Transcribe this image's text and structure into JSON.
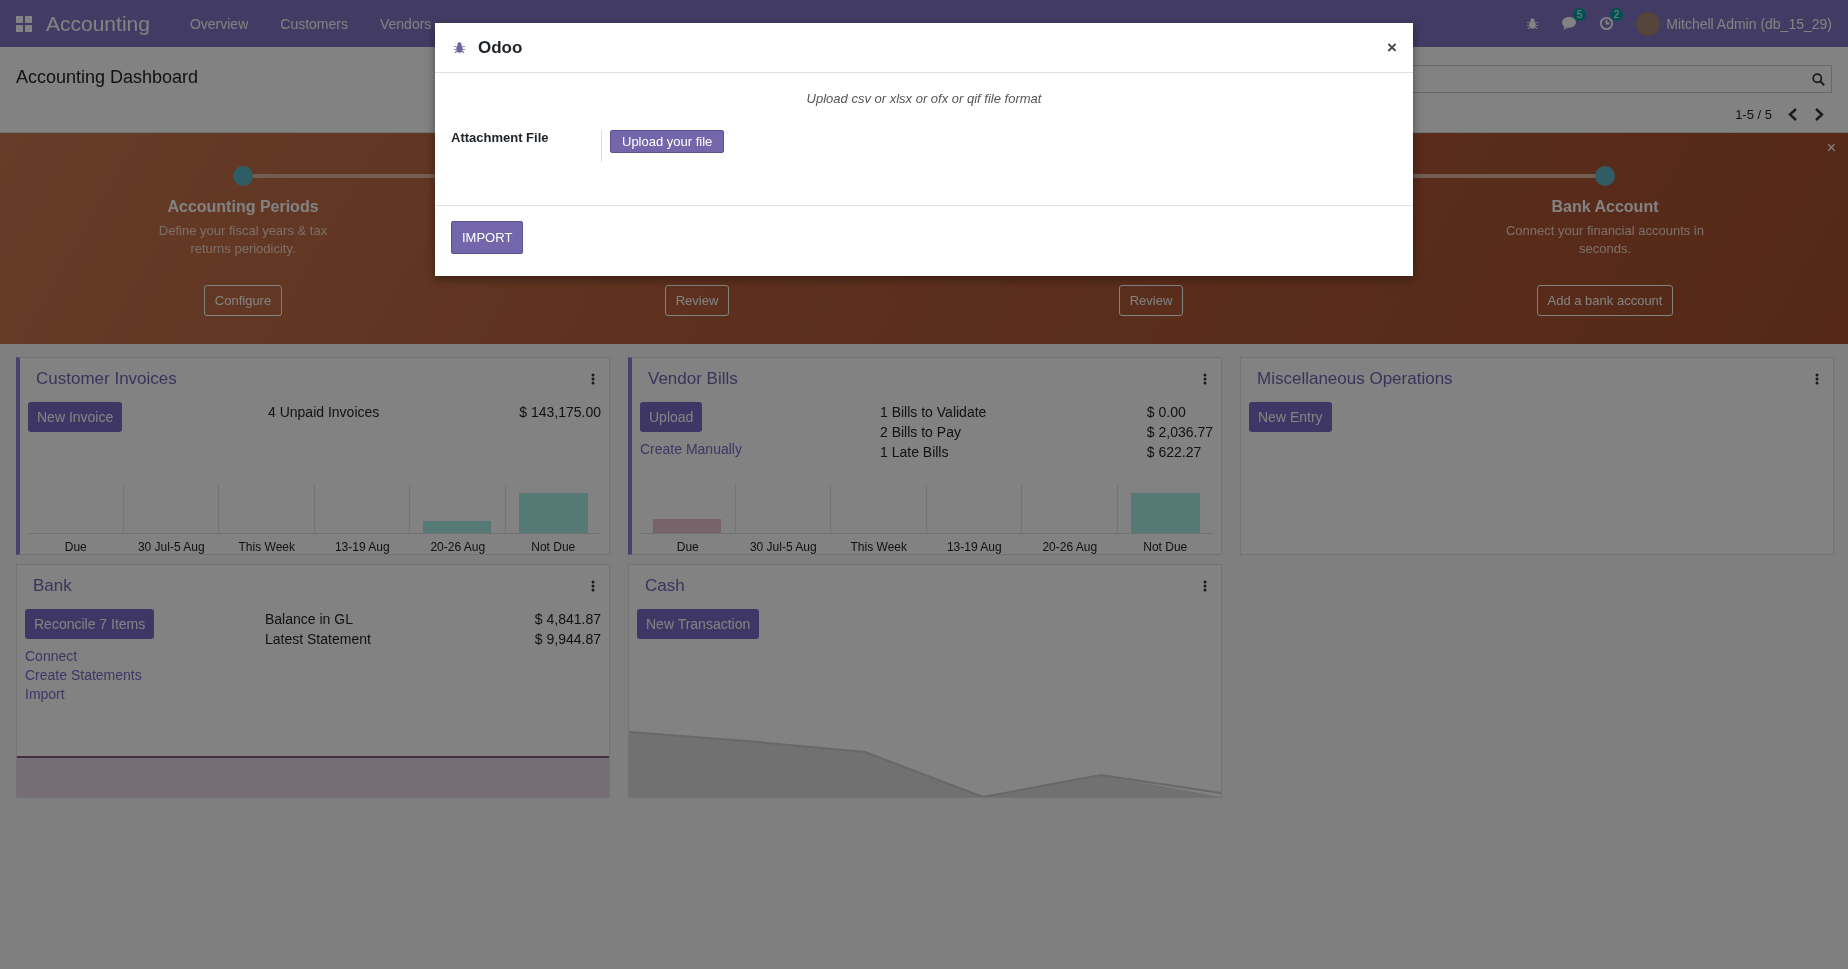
{
  "navbar": {
    "app": "Accounting",
    "menu": [
      "Overview",
      "Customers",
      "Vendors"
    ],
    "messages_count": "5",
    "activities_count": "2",
    "user": "Mitchell Admin (db_15_29)"
  },
  "control_panel": {
    "breadcrumb": "Accounting Dashboard",
    "pager": "1-5 / 5"
  },
  "onboarding": {
    "steps": [
      {
        "title": "Accounting Periods",
        "description": "Define your fiscal years & tax returns periodicity.",
        "button": "Configure"
      },
      {
        "button": "Review"
      },
      {
        "button": "Review"
      },
      {
        "title": "Bank Account",
        "description": "Connect your financial accounts in seconds.",
        "button": "Add a bank account"
      }
    ],
    "close": "×"
  },
  "journals": [
    {
      "title": "Customer Invoices",
      "kind": "bars",
      "accent": true,
      "actions": [
        {
          "label": "New Invoice",
          "kind": "button"
        }
      ],
      "stats": [
        {
          "label": "4 Unpaid Invoices",
          "value": "$ 143,175.00"
        }
      ],
      "bar_labels": [
        "Due",
        "30 Jul-5 Aug",
        "This Week",
        "13-19 Aug",
        "20-26 Aug",
        "Not Due"
      ]
    },
    {
      "title": "Vendor Bills",
      "kind": "bars",
      "accent": true,
      "actions": [
        {
          "label": "Upload",
          "kind": "button"
        },
        {
          "label": "Create Manually",
          "kind": "link"
        }
      ],
      "stats": [
        {
          "label": "1 Bills to Validate",
          "value": "$ 0.00"
        },
        {
          "label": "2 Bills to Pay",
          "value": "$ 2,036.77"
        },
        {
          "label": "1 Late Bills",
          "value": "$ 622.27"
        }
      ],
      "bar_labels": [
        "Due",
        "30 Jul-5 Aug",
        "This Week",
        "13-19 Aug",
        "20-26 Aug",
        "Not Due"
      ]
    },
    {
      "title": "Miscellaneous Operations",
      "kind": "none",
      "accent": false,
      "actions": [
        {
          "label": "New Entry",
          "kind": "button"
        }
      ]
    },
    {
      "title": "Bank",
      "kind": "line",
      "accent": false,
      "actions": [
        {
          "label": "Reconcile 7 Items",
          "kind": "button"
        },
        {
          "label": "Connect",
          "kind": "link"
        },
        {
          "label": "Create Statements",
          "kind": "link"
        },
        {
          "label": "Import",
          "kind": "link"
        }
      ],
      "stats": [
        {
          "label": "Balance in GL",
          "value": "$ 4,841.87"
        },
        {
          "label": "Latest Statement",
          "value": "$ 9,944.87"
        }
      ]
    },
    {
      "title": "Cash",
      "kind": "area",
      "accent": false,
      "actions": [
        {
          "label": "New Transaction",
          "kind": "button"
        }
      ]
    }
  ],
  "dialog": {
    "title": "Odoo",
    "close": "×",
    "hint": "Upload csv or xlsx or ofx or qif file format",
    "field_label": "Attachment File",
    "upload_button": "Upload your file",
    "import_button": "IMPORT"
  }
}
